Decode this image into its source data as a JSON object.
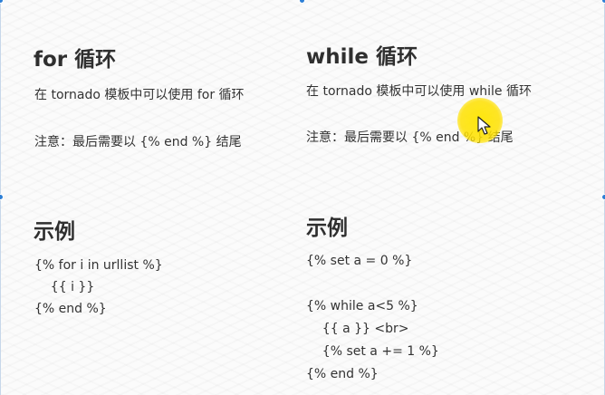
{
  "left": {
    "heading": "for 循环",
    "desc": "在 tornado 模板中可以使用 for 循环",
    "note": "注意：最后需要以 {% end %} 结尾",
    "example_heading": "示例",
    "code_lines": [
      "{% for i in urllist %}",
      "    {{ i }}",
      "{% end %}"
    ]
  },
  "right": {
    "heading": "while 循环",
    "desc": "在 tornado 模板中可以使用 while 循环",
    "note": "注意：最后需要以 {% end %} 结尾",
    "example_heading": "示例",
    "code_lines": [
      "{% set a = 0 %}",
      "",
      "{% while a<5 %}",
      "    {{ a }} <br>",
      "    {% set a += 1 %}",
      "{% end %}"
    ]
  },
  "icons": {
    "cursor": "arrow-cursor-icon",
    "highlight": "cursor-highlight-icon"
  },
  "colors": {
    "handle": "#2d7fd6",
    "highlight": "#ffe100",
    "text": "#333333"
  }
}
